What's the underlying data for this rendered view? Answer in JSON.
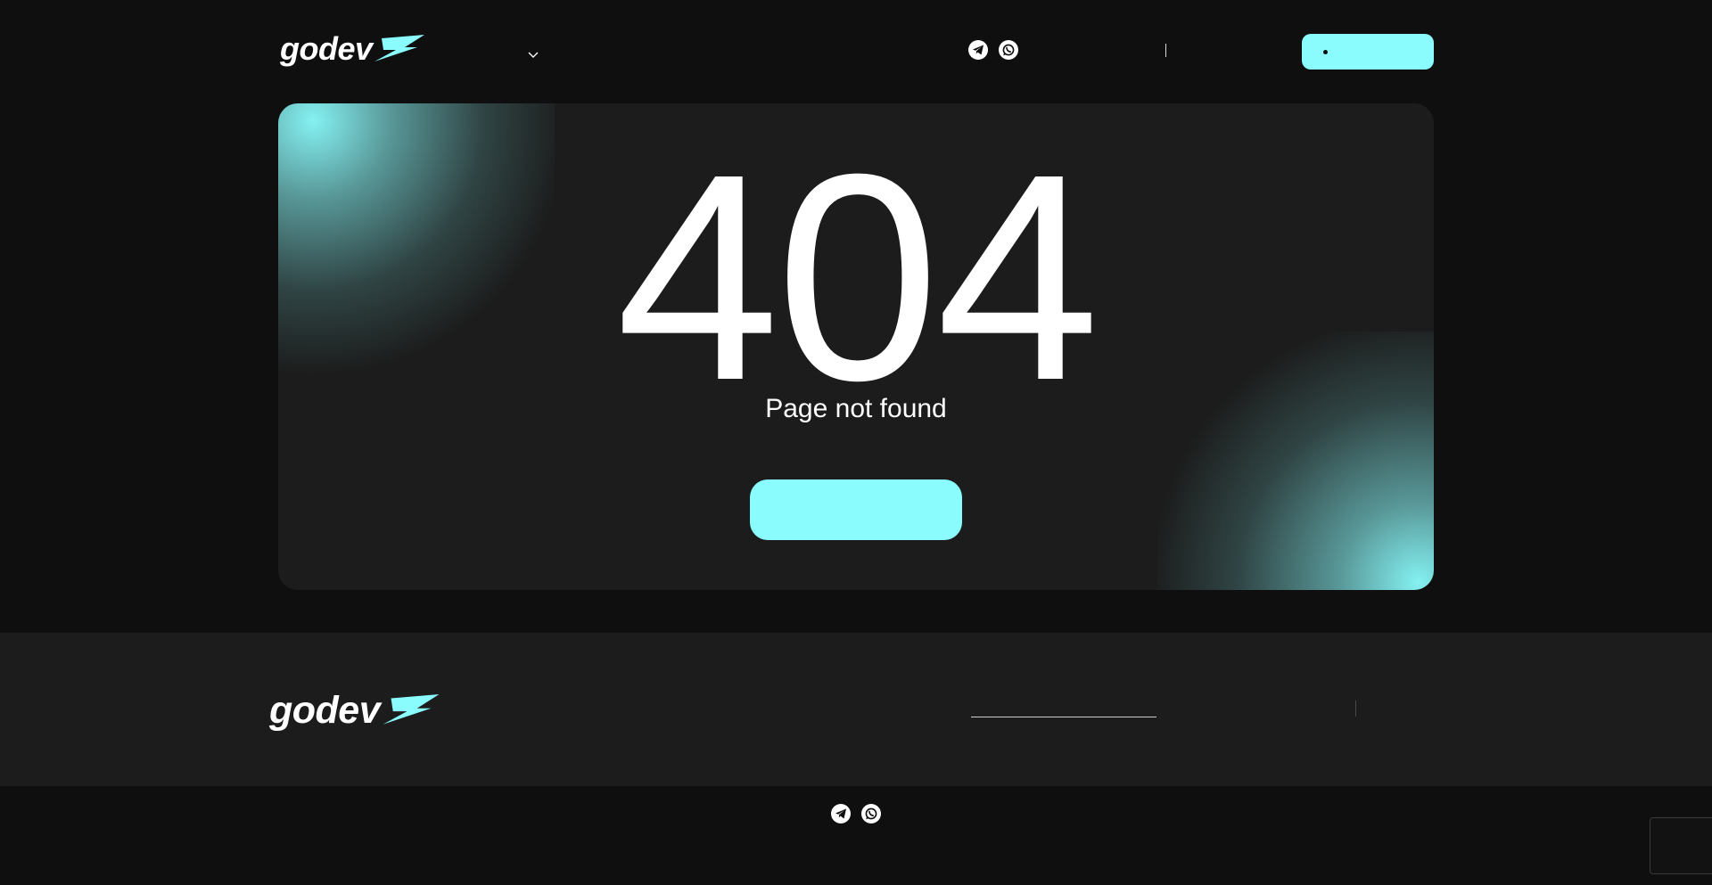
{
  "brand": {
    "name": "godev",
    "accent_color": "#8afcfd",
    "background_color": "#0f0f0f",
    "card_color": "#1c1c1c"
  },
  "header": {
    "logo_text": "godev",
    "dropdown_icon": "chevron-down-icon",
    "social_icons": [
      "telegram-icon",
      "whatsapp-icon"
    ],
    "cta_icon": "dot-icon"
  },
  "error": {
    "code": "404",
    "message": "Page not found"
  },
  "footer": {
    "logo_text": "godev",
    "social_icons": [
      "telegram-icon",
      "whatsapp-icon"
    ]
  }
}
